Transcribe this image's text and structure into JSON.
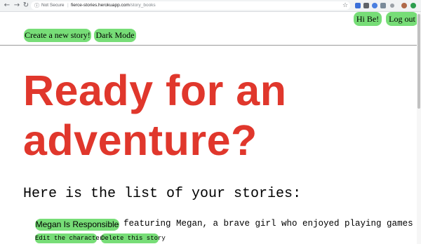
{
  "browser": {
    "security_label": "Not Secure",
    "separator": "|",
    "host": "fierce-stories.herokuapp.com",
    "path": "/story_books",
    "back_icon": "←",
    "forward_icon": "→",
    "reload_icon": "↻",
    "info_icon": "ⓘ",
    "star_icon": "☆"
  },
  "nav": {
    "create_label": "Create a new story!",
    "dark_mode_label": "Dark Mode",
    "greeting_label": "Hi Be!",
    "logout_label": "Log out"
  },
  "hero": {
    "line1": "Ready for an",
    "line2": "adventure?"
  },
  "list": {
    "title": "Here is the list of your stories:",
    "stories": [
      {
        "title": "Megan Is Responsible",
        "description": "featuring Megan, a brave girl who enjoyed playing games",
        "edit_label": "Edit the character",
        "delete_label": "Delete this story"
      }
    ]
  },
  "colors": {
    "accent_green": "#77dd77",
    "hero_red": "#e0372c"
  }
}
